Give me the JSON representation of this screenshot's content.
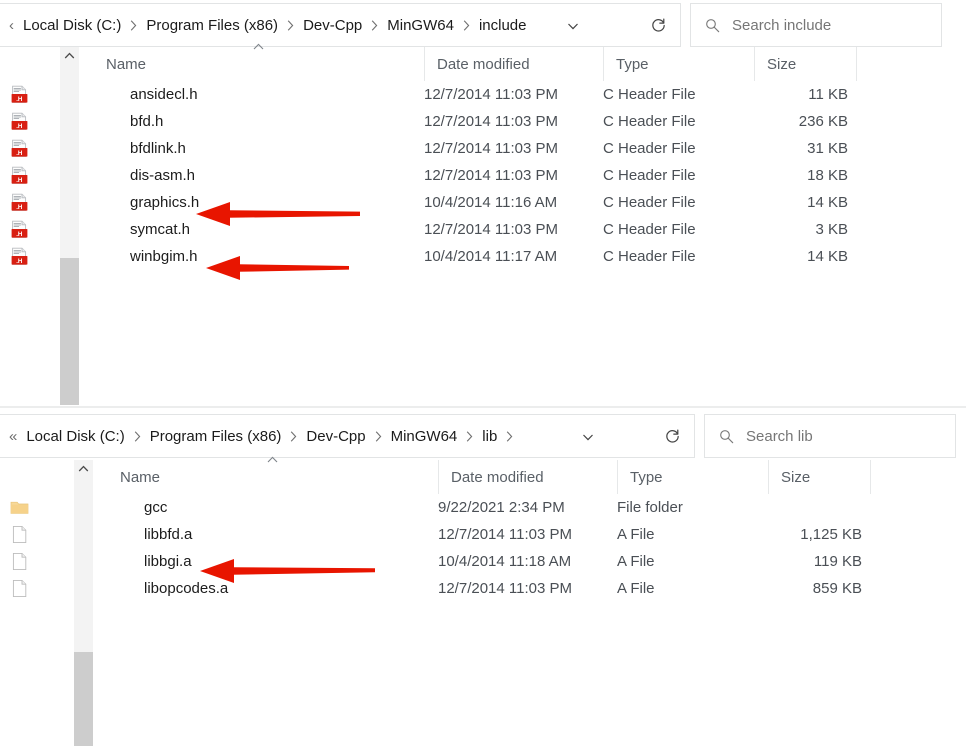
{
  "accent": {
    "arrow_red": "#e01b00",
    "folder_yellow": "#f6d28a",
    "header_text": "#5a6067"
  },
  "panes": [
    {
      "id": "include",
      "breadcrumb": {
        "lead": "‹",
        "crumbs": [
          "Local Disk (C:)",
          "Program Files (x86)",
          "Dev-Cpp",
          "MinGW64",
          "include"
        ],
        "trailing_sep": false
      },
      "dropdown_icon": "chevron-down-icon",
      "refresh_icon": "refresh-icon",
      "search": {
        "icon": "search-icon",
        "placeholder": "Search include",
        "value": ""
      },
      "columns": [
        "Name",
        "Date modified",
        "Type",
        "Size"
      ],
      "sort": {
        "column": "Name",
        "direction": "ascending"
      },
      "files": [
        {
          "name": "ansidecl.h",
          "date": "12/7/2014 11:03 PM",
          "type": "C Header File",
          "size": "11 KB",
          "icon": "c-header-file-icon"
        },
        {
          "name": "bfd.h",
          "date": "12/7/2014 11:03 PM",
          "type": "C Header File",
          "size": "236 KB",
          "icon": "c-header-file-icon"
        },
        {
          "name": "bfdlink.h",
          "date": "12/7/2014 11:03 PM",
          "type": "C Header File",
          "size": "31 KB",
          "icon": "c-header-file-icon"
        },
        {
          "name": "dis-asm.h",
          "date": "12/7/2014 11:03 PM",
          "type": "C Header File",
          "size": "18 KB",
          "icon": "c-header-file-icon"
        },
        {
          "name": "graphics.h",
          "date": "10/4/2014 11:16 AM",
          "type": "C Header File",
          "size": "14 KB",
          "icon": "c-header-file-icon"
        },
        {
          "name": "symcat.h",
          "date": "12/7/2014 11:03 PM",
          "type": "C Header File",
          "size": "3 KB",
          "icon": "c-header-file-icon"
        },
        {
          "name": "winbgim.h",
          "date": "10/4/2014 11:17 AM",
          "type": "C Header File",
          "size": "14 KB",
          "icon": "c-header-file-icon"
        }
      ],
      "annotations": [
        {
          "target": "graphics.h",
          "shape": "arrow-left"
        },
        {
          "target": "winbgim.h",
          "shape": "arrow-left"
        }
      ]
    },
    {
      "id": "lib",
      "breadcrumb": {
        "lead": "«",
        "crumbs": [
          "Local Disk (C:)",
          "Program Files (x86)",
          "Dev-Cpp",
          "MinGW64",
          "lib"
        ],
        "trailing_sep": true
      },
      "dropdown_icon": "chevron-down-icon",
      "refresh_icon": "refresh-icon",
      "search": {
        "icon": "search-icon",
        "placeholder": "Search lib",
        "value": ""
      },
      "columns": [
        "Name",
        "Date modified",
        "Type",
        "Size"
      ],
      "sort": {
        "column": "Name",
        "direction": "ascending"
      },
      "files": [
        {
          "name": "gcc",
          "date": "9/22/2021 2:34 PM",
          "type": "File folder",
          "size": "",
          "icon": "folder-icon"
        },
        {
          "name": "libbfd.a",
          "date": "12/7/2014 11:03 PM",
          "type": "A File",
          "size": "1,125 KB",
          "icon": "generic-file-icon"
        },
        {
          "name": "libbgi.a",
          "date": "10/4/2014 11:18 AM",
          "type": "A File",
          "size": "119 KB",
          "icon": "generic-file-icon"
        },
        {
          "name": "libopcodes.a",
          "date": "12/7/2014 11:03 PM",
          "type": "A File",
          "size": "859 KB",
          "icon": "generic-file-icon"
        }
      ],
      "annotations": [
        {
          "target": "libbgi.a",
          "shape": "arrow-left"
        }
      ]
    }
  ]
}
